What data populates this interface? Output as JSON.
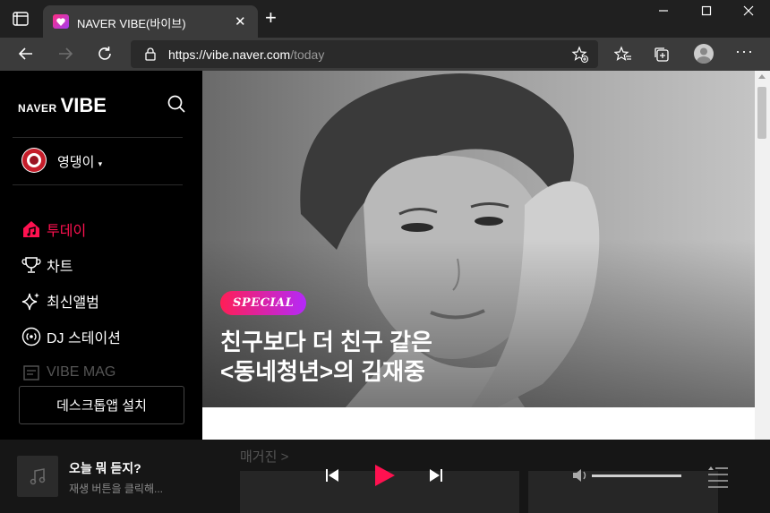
{
  "browser": {
    "tab_title": "NAVER VIBE(바이브)",
    "url_host": "https://vibe.naver.com",
    "url_path": "/today"
  },
  "sidebar": {
    "logo_naver": "NAVER",
    "logo_vibe": "VIBE",
    "profile_name": "영댕이",
    "menu": [
      {
        "label": "투데이",
        "icon": "home-icon",
        "active": true
      },
      {
        "label": "차트",
        "icon": "trophy-icon",
        "active": false
      },
      {
        "label": "최신앨범",
        "icon": "sparkle-icon",
        "active": false
      },
      {
        "label": "DJ 스테이션",
        "icon": "radio-icon",
        "active": false
      },
      {
        "label": "VIBE MAG",
        "icon": "magazine-icon",
        "active": false
      }
    ],
    "install_button": "데스크톱앱 설치"
  },
  "main": {
    "hero_badge": "SPECIAL",
    "hero_title_line1": "친구보다 더 친구 같은",
    "hero_title_line2": "<동네청년>의 김재중",
    "next_section_peek": "매거진 >"
  },
  "player": {
    "track_title": "오늘 뭐 듣지?",
    "track_subtitle": "재생 버튼을 클릭해...",
    "volume": 1.0
  },
  "colors": {
    "accent": "#ff1150",
    "badge_from": "#ff1e56",
    "badge_to": "#b429f9"
  }
}
